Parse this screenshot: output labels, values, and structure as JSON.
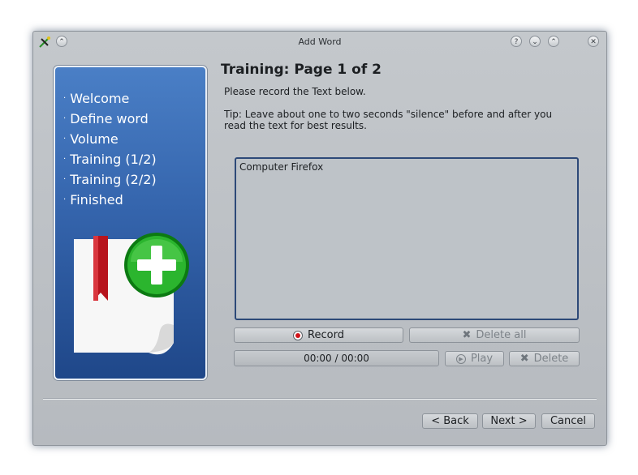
{
  "window": {
    "title": "Add Word"
  },
  "sidebar": {
    "steps": [
      {
        "label": "Welcome"
      },
      {
        "label": "Define word"
      },
      {
        "label": "Volume"
      },
      {
        "label": "Training (1/2)"
      },
      {
        "label": "Training (2/2)"
      },
      {
        "label": "Finished"
      }
    ]
  },
  "page": {
    "heading": "Training: Page 1 of 2",
    "instruction": "Please record the Text below.",
    "tip": "Tip: Leave about one to two seconds \"silence\" before and after you read the text for best results.",
    "prompt_text": "Computer Firefox"
  },
  "recording": {
    "record_label": "Record",
    "delete_all_label": "Delete all",
    "time": "00:00 / 00:00",
    "play_label": "Play",
    "delete_label": "Delete"
  },
  "footer": {
    "back_label": "< Back",
    "next_label": "Next >",
    "cancel_label": "Cancel"
  },
  "colors": {
    "sidebar_top": "#4a7fc6",
    "sidebar_bottom": "#1f4789",
    "record_red": "#d0141a"
  }
}
